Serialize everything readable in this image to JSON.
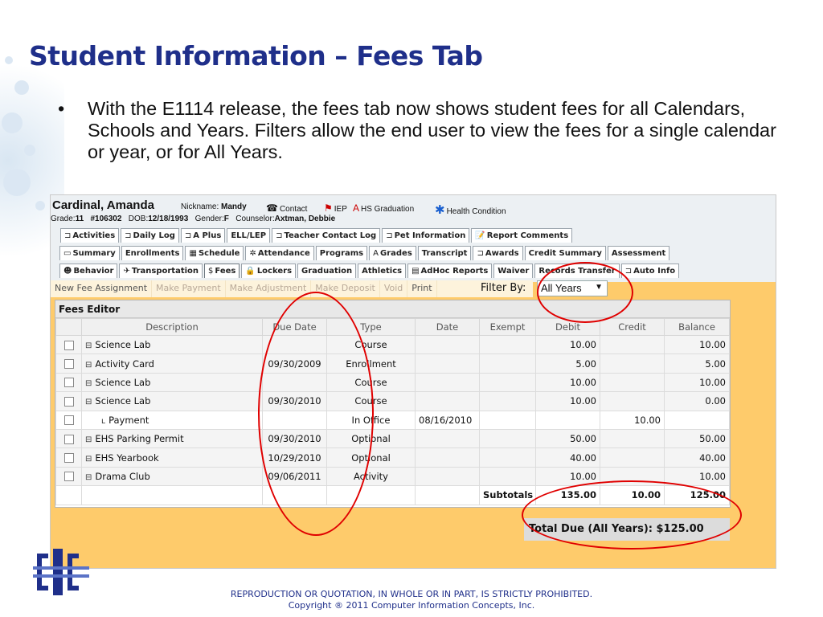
{
  "slide": {
    "title": "Student Information – Fees Tab",
    "bullet_mark": "•",
    "bullet": "With the E1114 release, the fees tab now shows student fees for all Calendars, Schools and Years.  Filters allow the end user to view the fees for a single calendar or year, or for All Years."
  },
  "student": {
    "name": "Cardinal, Amanda",
    "nickname_label": "Nickname:",
    "nickname": "Mandy",
    "contact": "Contact",
    "iep": "IEP",
    "hs_graduation": "HS Graduation",
    "health_condition": "Health Condition",
    "grade_label": "Grade:",
    "grade": "11",
    "id": "#106302",
    "dob_label": "DOB:",
    "dob": "12/18/1993",
    "gender_label": "Gender:",
    "gender": "F",
    "counselor_label": "Counselor:",
    "counselor": "Axtman, Debbie"
  },
  "tabs": {
    "row1": [
      {
        "label": "Activities",
        "icon": "⊐"
      },
      {
        "label": "Daily Log",
        "icon": "⊐"
      },
      {
        "label": "A Plus",
        "icon": "⊐"
      },
      {
        "label": "ELL/LEP",
        "icon": ""
      },
      {
        "label": "Teacher Contact Log",
        "icon": "⊐"
      },
      {
        "label": "Pet Information",
        "icon": "⊐"
      },
      {
        "label": "Report Comments",
        "icon": "📝"
      }
    ],
    "row2": [
      {
        "label": "Summary",
        "icon": "▭"
      },
      {
        "label": "Enrollments",
        "icon": ""
      },
      {
        "label": "Schedule",
        "icon": "▦"
      },
      {
        "label": "Attendance",
        "icon": "✲"
      },
      {
        "label": "Programs",
        "icon": ""
      },
      {
        "label": "Grades",
        "icon": "A"
      },
      {
        "label": "Transcript",
        "icon": ""
      },
      {
        "label": "Awards",
        "icon": "⊐"
      },
      {
        "label": "Credit Summary",
        "icon": ""
      },
      {
        "label": "Assessment",
        "icon": ""
      }
    ],
    "row3": [
      {
        "label": "Behavior",
        "icon": "☻"
      },
      {
        "label": "Transportation",
        "icon": "✈"
      },
      {
        "label": "Fees",
        "icon": "$",
        "active": true
      },
      {
        "label": "Lockers",
        "icon": "🔒"
      },
      {
        "label": "Graduation",
        "icon": ""
      },
      {
        "label": "Athletics",
        "icon": ""
      },
      {
        "label": "AdHoc Reports",
        "icon": "▤"
      },
      {
        "label": "Waiver",
        "icon": ""
      },
      {
        "label": "Records Transfer",
        "icon": ""
      },
      {
        "label": "Auto Info",
        "icon": "⊐"
      }
    ]
  },
  "actions": [
    {
      "label": "New Fee Assignment",
      "enabled": true
    },
    {
      "label": "Make Payment",
      "enabled": false
    },
    {
      "label": "Make Adjustment",
      "enabled": false
    },
    {
      "label": "Make Deposit",
      "enabled": false
    },
    {
      "label": "Void",
      "enabled": false
    },
    {
      "label": "Print",
      "enabled": true
    }
  ],
  "filter": {
    "label": "Filter By:",
    "value": "All Years"
  },
  "editor": {
    "title": "Fees Editor",
    "columns": [
      "",
      "Description",
      "Due Date",
      "Type",
      "Date",
      "Exempt",
      "Debit",
      "Credit",
      "Balance"
    ],
    "rows": [
      {
        "desc": "Science Lab",
        "expander": "⊟",
        "due": "",
        "due_red": false,
        "type": "Course",
        "date": "",
        "exempt": "",
        "debit": "10.00",
        "credit": "",
        "balance": "10.00"
      },
      {
        "desc": "Activity Card",
        "expander": "⊟",
        "due": "09/30/2009",
        "due_red": true,
        "type": "Enrollment",
        "date": "",
        "exempt": "",
        "debit": "5.00",
        "credit": "",
        "balance": "5.00"
      },
      {
        "desc": "Science Lab",
        "expander": "⊟",
        "due": "",
        "due_red": false,
        "type": "Course",
        "date": "",
        "exempt": "",
        "debit": "10.00",
        "credit": "",
        "balance": "10.00"
      },
      {
        "desc": "Science Lab",
        "expander": "⊟",
        "due": "09/30/2010",
        "due_red": false,
        "type": "Course",
        "date": "",
        "exempt": "",
        "debit": "10.00",
        "credit": "",
        "balance": "0.00"
      },
      {
        "desc": "Payment",
        "expander": "ʟ",
        "child": true,
        "due": "",
        "due_red": false,
        "type": "In Office",
        "date": "08/16/2010",
        "exempt": "",
        "debit": "",
        "credit": "10.00",
        "balance": ""
      },
      {
        "desc": "EHS Parking Permit",
        "expander": "⊟",
        "due": "09/30/2010",
        "due_red": true,
        "type": "Optional",
        "date": "",
        "exempt": "",
        "debit": "50.00",
        "credit": "",
        "balance": "50.00"
      },
      {
        "desc": "EHS Yearbook",
        "expander": "⊟",
        "due": "10/29/2010",
        "due_red": true,
        "type": "Optional",
        "date": "",
        "exempt": "",
        "debit": "40.00",
        "credit": "",
        "balance": "40.00"
      },
      {
        "desc": "Drama Club",
        "expander": "⊟",
        "due": "09/06/2011",
        "due_red": false,
        "type": "Activity",
        "date": "",
        "exempt": "",
        "debit": "10.00",
        "credit": "",
        "balance": "10.00"
      }
    ],
    "subtotal": {
      "label": "Subtotals",
      "debit": "135.00",
      "credit": "10.00",
      "balance": "125.00"
    },
    "total_due": "Total Due (All Years):  $125.00"
  },
  "footer": {
    "line1": "REPRODUCTION OR QUOTATION, IN WHOLE OR IN PART, IS STRICTLY PROHIBITED.",
    "line2": "Copyright ® 2011 Computer Information Concepts, Inc."
  },
  "colors": {
    "title": "#1f2f8a",
    "panel": "#fecb6b",
    "highlight_ring": "#e00000",
    "overdue": "#d8201f"
  }
}
